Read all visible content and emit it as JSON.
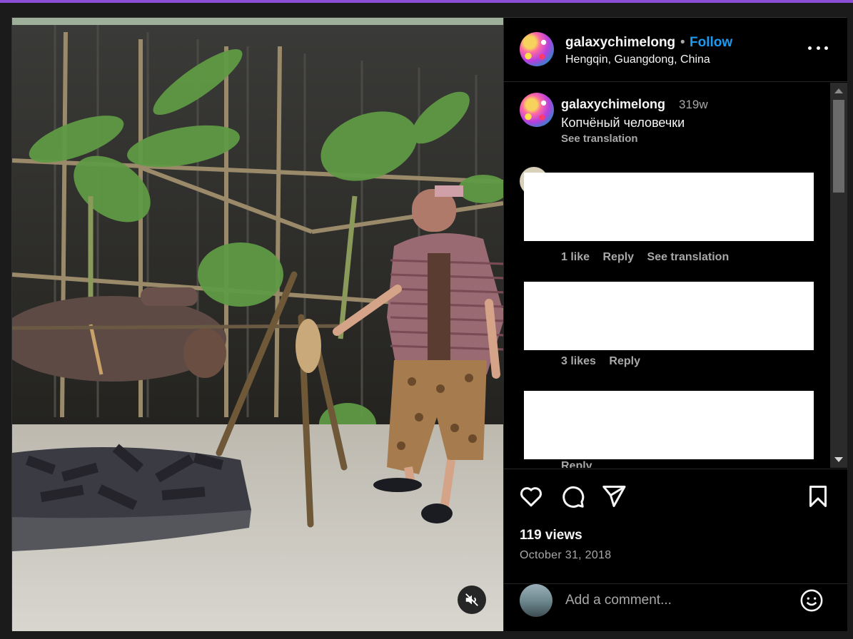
{
  "post": {
    "username": "galaxychimelong",
    "separator": "•",
    "follow_label": "Follow",
    "location": "Hengqin, Guangdong, China",
    "more_icon": "more-horizontal-icon"
  },
  "caption": {
    "username": "galaxychimelong",
    "time": "319w",
    "text": "Копчёный человечки",
    "translate_label": "See translation"
  },
  "comments": [
    {
      "likes": "1 like",
      "reply": "Reply",
      "translate": "See translation"
    },
    {
      "likes": "3 likes",
      "reply": "Reply"
    },
    {
      "reply": "Reply"
    }
  ],
  "actions": {
    "like_icon": "heart-icon",
    "comment_icon": "comment-icon",
    "share_icon": "send-icon",
    "save_icon": "bookmark-icon"
  },
  "views": "119 views",
  "date": "October 31, 2018",
  "add_comment": {
    "placeholder": "Add a comment...",
    "emoji_icon": "smiley-icon"
  },
  "video": {
    "mute_icon": "muted-speaker-icon"
  },
  "colors": {
    "accent": "#1a9bf0",
    "background": "#000000",
    "muted_text": "#a8a8a8"
  }
}
